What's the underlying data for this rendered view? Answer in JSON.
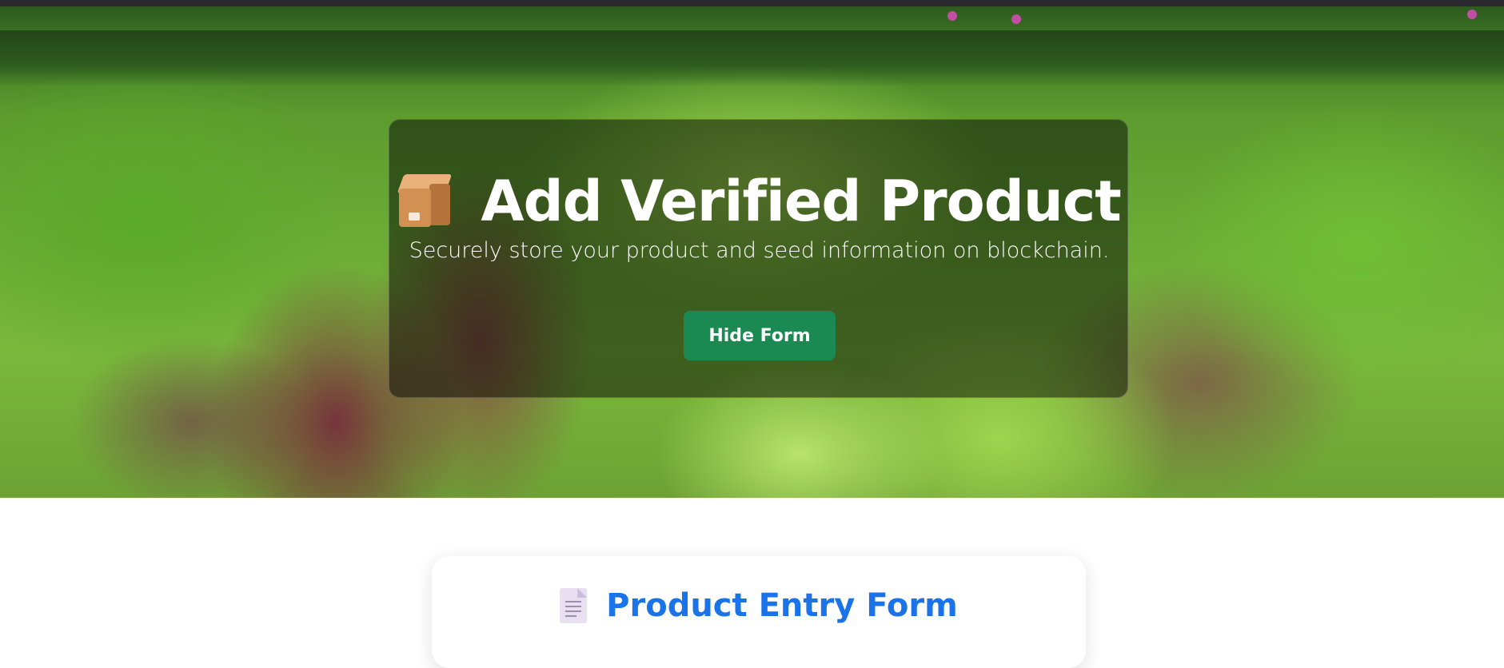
{
  "hero": {
    "title": "Add Verified Product",
    "title_icon": "package-box-icon",
    "subtitle": "Securely store your product and seed information on blockchain.",
    "toggle_button_label": "Hide Form"
  },
  "form": {
    "title": "Product Entry Form",
    "title_icon": "document-icon"
  },
  "colors": {
    "primary_button": "#1a8a52",
    "form_title": "#1a73e8",
    "hero_overlay": "rgba(0,0,0,0.48)"
  }
}
